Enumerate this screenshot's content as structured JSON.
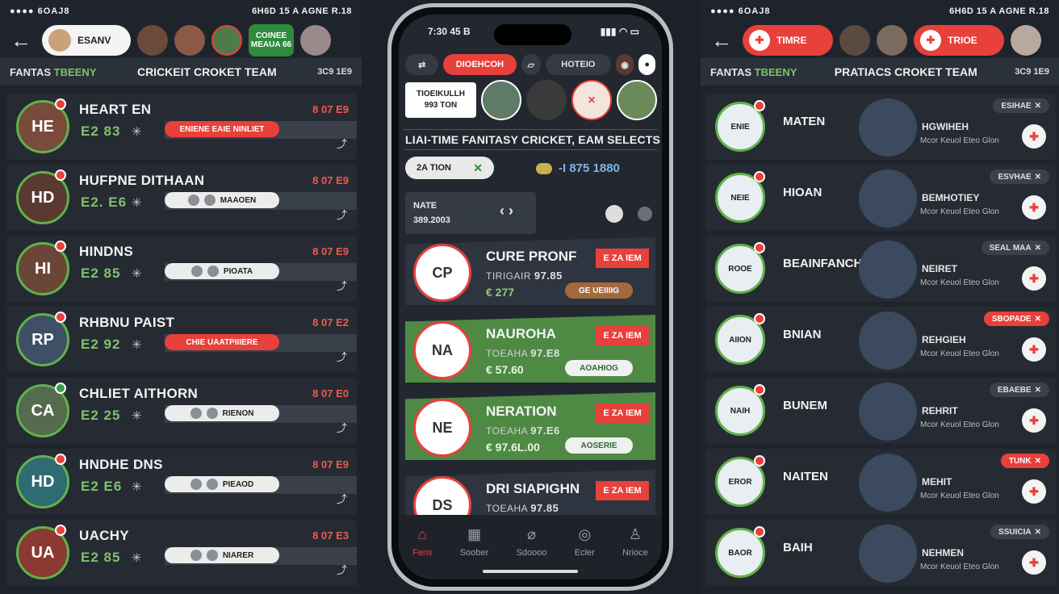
{
  "left": {
    "status_left": "●●●● 6OAJ8",
    "status_right": "6H6D 15 A AGNE  R.18",
    "pill_label": "ESANV",
    "green_tag_line1": "COINEE",
    "green_tag_line2": "MEAUA 66",
    "brand_a": "FANTAS ",
    "brand_b": "TBEENY",
    "title": "CRICKEIT CROKET TEAM",
    "count": "3C9 1E9",
    "rows": [
      {
        "name": "HEART EN",
        "score": "E2 83",
        "price": "8 07 E9",
        "tag": "ENIENE EAIE NINLIET",
        "tag_style": "red",
        "initials": "HE",
        "color": "#7a4a3a"
      },
      {
        "name": "HUFPNE DITHAAN",
        "score": "E2. E6",
        "price": "8 07 E9",
        "tag": "MAAOEN",
        "tag_style": "white",
        "initials": "HD",
        "color": "#5a3a30"
      },
      {
        "name": "HINDNS",
        "score": "E2 85",
        "price": "8 07 E9",
        "tag": "PIOATA",
        "tag_style": "white",
        "initials": "HI",
        "color": "#6b4636"
      },
      {
        "name": "RHBNU PAIST",
        "score": "E2 92",
        "price": "8 07 E2",
        "tag": "CHIE UAATPIIIERE",
        "tag_style": "red",
        "initials": "RP",
        "color": "#3f4f66"
      },
      {
        "name": "CHLIET AITHORN",
        "score": "E2 25",
        "price": "8 07 E0",
        "tag": "RIENON",
        "tag_style": "white",
        "initials": "CA",
        "color": "#556b4e"
      },
      {
        "name": "HNDHE DNS",
        "score": "E2 E6",
        "price": "8 07 E9",
        "tag": "PIEAOD",
        "tag_style": "white",
        "initials": "HD",
        "color": "#2f6b72"
      },
      {
        "name": "UACHY",
        "score": "E2 85",
        "price": "8 07 E3",
        "tag": "NIARER",
        "tag_style": "white",
        "initials": "UA",
        "color": "#8a3a32"
      }
    ]
  },
  "phone": {
    "time": "7:30 45 B",
    "signal": "▮▮▮ ◠ ▭",
    "tab_active": "DIOEHCOH",
    "tab_3": "HOTEIO",
    "card_line1": "TIOEIKULLH",
    "card_line2": "993 TON",
    "title": "LIAI-TIME FANITASY CRICKET, EAM SELECTS",
    "filter": "2A TION",
    "credit": "-I 875 1880",
    "match_line1": "NATE",
    "match_line2": "389.2003",
    "cards": [
      {
        "name": "CURE PRONF",
        "meta_prefix": "TIRIGAIR  ",
        "meta_value": "97.85",
        "value": "€ 277",
        "badge": "E ZA IEM",
        "button": "GE UEIIIIG",
        "style": "dark",
        "btn_style": "brown",
        "initials": "CP"
      },
      {
        "name": "NAUROHA",
        "meta_prefix": "TOEAHA  ",
        "meta_value": "97.E8",
        "value": "€ 57.60",
        "badge": "E ZA IEM",
        "button": "AOAHIOG",
        "style": "green",
        "btn_style": "white",
        "initials": "NA"
      },
      {
        "name": "NERATION",
        "meta_prefix": "TOEAHA  ",
        "meta_value": "97.E6",
        "value": "€ 97.6L.00",
        "badge": "E ZA IEM",
        "button": "AOSERIE",
        "style": "green",
        "btn_style": "white",
        "initials": "NE"
      },
      {
        "name": "DRI SIAPIGHN",
        "meta_prefix": "TOEAHA  ",
        "meta_value": "97.85",
        "value": "",
        "badge": "E ZA IEM",
        "button": "",
        "style": "dark",
        "btn_style": "brown",
        "initials": "DS"
      }
    ],
    "nav": [
      "Fens",
      "Soober",
      "Sdoooo",
      "Ecler",
      "Nrioce"
    ]
  },
  "right": {
    "status_left": "●●●● 6OAJ8",
    "status_right": "6H6D 15 A AGNE  R.18",
    "pill1": "TIMRE",
    "pill2": "TRIOE",
    "brand_a": "FANTAS ",
    "brand_b": "TBEENY",
    "title": "PRATIACS CROKET TEAM",
    "count": "3C9 1E9",
    "rows": [
      {
        "name": "MATEN",
        "initials": "ENIE",
        "role": "HGWIHEH",
        "sub": "Mcor Keuol Eteo Glon",
        "chip": "ESIHAE",
        "chip_style": "dark"
      },
      {
        "name": "HIOAN",
        "initials": "NEIE",
        "role": "BEMHOTIEY",
        "sub": "Mcor Keuol Eteo Glon",
        "chip": "ESVHAE",
        "chip_style": "dark"
      },
      {
        "name": "BEAINFANCH",
        "initials": "ROOE",
        "role": "NEIRET",
        "sub": "Mcor Keuol Eteo Glon",
        "chip": "SEAL MAA",
        "chip_style": "dark"
      },
      {
        "name": "BNIAN",
        "initials": "AIION",
        "role": "REHGIEH",
        "sub": "Mcor Keuol Eteo Glon",
        "chip": "SBOPADE",
        "chip_style": "red"
      },
      {
        "name": "BUNEM",
        "initials": "NAIH",
        "role": "REHRIT",
        "sub": "Mcor Keuol Eteo Glon",
        "chip": "EBAEBE",
        "chip_style": "dark"
      },
      {
        "name": "NAITEN",
        "initials": "EROR",
        "role": "MEHIT",
        "sub": "Mcor Keuol Eteo Glon",
        "chip": "TUNK",
        "chip_style": "red"
      },
      {
        "name": "BAIH",
        "initials": "BAOR",
        "role": "NEHMEN",
        "sub": "Mcor Keuol Eteo Glon",
        "chip": "SSUICIA",
        "chip_style": "dark"
      }
    ]
  }
}
